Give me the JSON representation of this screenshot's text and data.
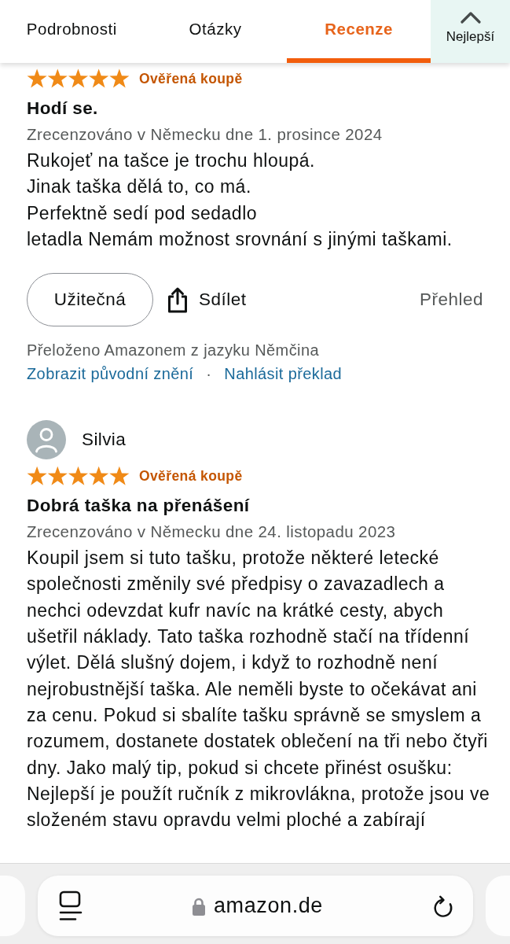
{
  "tabs": [
    {
      "label": "Podrobnosti",
      "selected": false
    },
    {
      "label": "Otázky",
      "selected": false
    },
    {
      "label": "Recenze",
      "selected": true
    }
  ],
  "sort_button": {
    "label": "Nejlepší"
  },
  "reviews": [
    {
      "stars": 5,
      "badge": "Ověřená koupě",
      "title": "Hodí se.",
      "meta": "Zrecenzováno v Německu dne 1. prosince 2024",
      "body": "Rukojeť na tašce je trochu hloupá.\nJinak taška dělá to, co má.\nPerfektně sedí pod sedadlo\nletadla Nemám možnost srovnání s jinými taškami.",
      "actions": {
        "helpful": "Užitečná",
        "share": "Sdílet",
        "report": "Přehled"
      },
      "translation": {
        "note": "Přeloženo Amazonem z jazyku Němčina",
        "links": [
          "Zobrazit původní znění",
          "Nahlásit překlad"
        ],
        "separator": "·"
      }
    },
    {
      "author": "Silvia",
      "stars": 5,
      "badge": "Ověřená koupě",
      "title": "Dobrá taška na přenášení",
      "meta": "Zrecenzováno v Německu dne 24. listopadu 2023",
      "body": "Koupil jsem si tuto tašku, protože některé letecké společnosti změnily své předpisy o zavazadlech a nechci odevzdat kufr navíc na krátké cesty, abych ušetřil náklady. Tato taška rozhodně stačí na třídenní výlet. Dělá slušný dojem, i když to rozhodně není nejrobustnější taška. Ale neměli byste to očekávat ani za cenu. Pokud si sbalíte tašku správně se smyslem a rozumem, dostanete dostatek oblečení na tři nebo čtyři dny. Jako malý tip, pokud si chcete přinést osušku: Nejlepší je použít ručník z mikrovlákna, protože jsou ve složeném stavu opravdu velmi ploché a zabírají"
    }
  ],
  "address_bar": {
    "url": "amazon.de"
  }
}
